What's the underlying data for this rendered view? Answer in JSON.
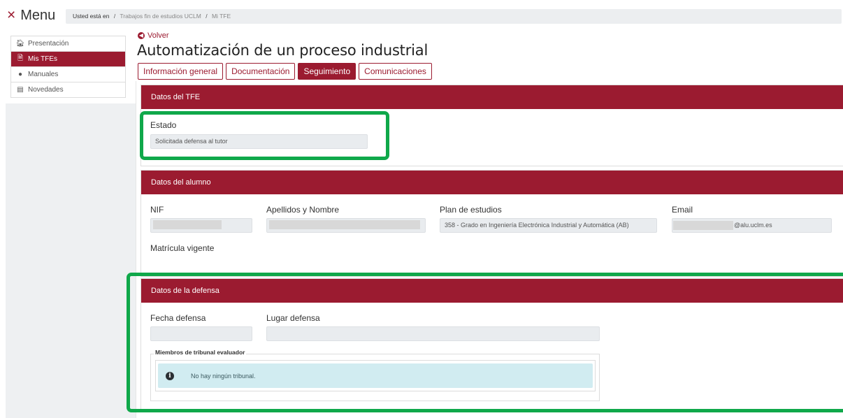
{
  "topbar": {
    "menu_icon": "×",
    "menu_label": "Menu",
    "breadcrumb_lead": "Usted está en",
    "breadcrumb_sep": "/",
    "breadcrumbs": [
      "Trabajos fin de estudios UCLM",
      "Mi TFE"
    ]
  },
  "sidebar": {
    "items": [
      {
        "label": "Presentación",
        "icon": "home-icon",
        "glyph": "🏠︎"
      },
      {
        "label": "Mis TFEs",
        "icon": "file-icon",
        "glyph": "🗎",
        "active": true
      },
      {
        "label": "Manuales",
        "icon": "info-circle-icon",
        "glyph": "●"
      },
      {
        "label": "Novedades",
        "icon": "newspaper-icon",
        "glyph": "▤"
      }
    ]
  },
  "header": {
    "back_label": "Volver",
    "title": "Automatización de un proceso industrial"
  },
  "tabs": [
    {
      "label": "Información general",
      "active": false
    },
    {
      "label": "Documentación",
      "active": false
    },
    {
      "label": "Seguimiento",
      "active": true
    },
    {
      "label": "Comunicaciones",
      "active": false
    }
  ],
  "datos_tfe": {
    "title": "Datos del TFE",
    "estado_label": "Estado",
    "estado_value": "Solicitada defensa al tutor"
  },
  "datos_alumno": {
    "title": "Datos del alumno",
    "nif_label": "NIF",
    "nombre_label": "Apellidos y Nombre",
    "plan_label": "Plan de estudios",
    "plan_value": "358 - Grado en Ingeniería Electrónica Industrial y Automática (AB)",
    "email_label": "Email",
    "email_value": "@alu.uclm.es",
    "matricula_label": "Matrícula vigente"
  },
  "datos_defensa": {
    "title": "Datos de la defensa",
    "fecha_label": "Fecha defensa",
    "lugar_label": "Lugar defensa",
    "tribunal_legend": "Miembros de tribunal evaluador",
    "tribunal_empty": "No hay ningún tribunal."
  },
  "colors": {
    "primary": "#9b1b30",
    "highlight": "#0fa84a",
    "alert_bg": "#d1ecf1",
    "field_bg": "#e9ecef"
  }
}
